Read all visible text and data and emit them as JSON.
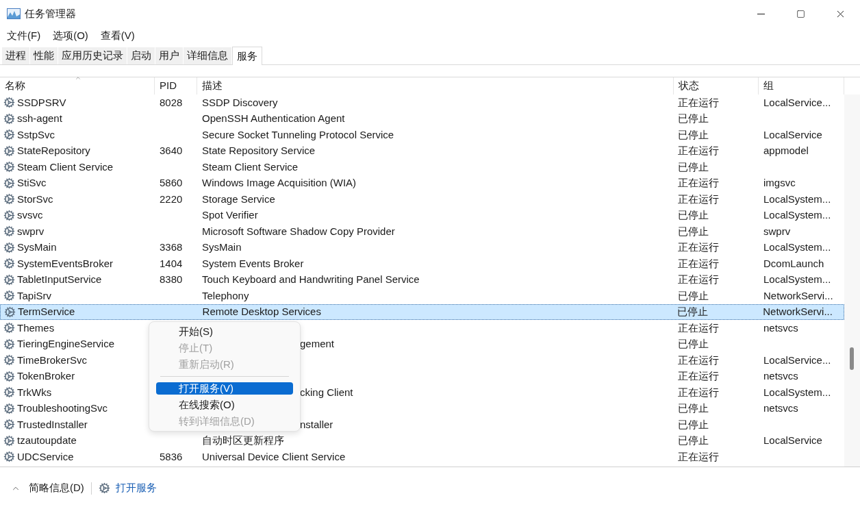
{
  "window": {
    "title": "任务管理器"
  },
  "menu": [
    "文件(F)",
    "选项(O)",
    "查看(V)"
  ],
  "tabs": [
    {
      "label": "进程",
      "selected": false
    },
    {
      "label": "性能",
      "selected": false
    },
    {
      "label": "应用历史记录",
      "selected": false
    },
    {
      "label": "启动",
      "selected": false
    },
    {
      "label": "用户",
      "selected": false
    },
    {
      "label": "详细信息",
      "selected": false
    },
    {
      "label": "服务",
      "selected": true
    }
  ],
  "table": {
    "columns": [
      "名称",
      "PID",
      "描述",
      "状态",
      "组"
    ],
    "rows": [
      {
        "name": "SSDPSRV",
        "pid": "8028",
        "description": "SSDP Discovery",
        "status": "正在运行",
        "group": "LocalService...",
        "selected": false
      },
      {
        "name": "ssh-agent",
        "description": "OpenSSH Authentication Agent",
        "status": "已停止",
        "selected": false
      },
      {
        "name": "SstpSvc",
        "description": "Secure Socket Tunneling Protocol Service",
        "status": "已停止",
        "group": "LocalService",
        "selected": false
      },
      {
        "name": "StateRepository",
        "pid": "3640",
        "description": "State Repository Service",
        "status": "正在运行",
        "group": "appmodel",
        "selected": false
      },
      {
        "name": "Steam Client Service",
        "description": "Steam Client Service",
        "status": "已停止",
        "selected": false
      },
      {
        "name": "StiSvc",
        "pid": "5860",
        "description": "Windows Image Acquisition (WIA)",
        "status": "正在运行",
        "group": "imgsvc",
        "selected": false
      },
      {
        "name": "StorSvc",
        "pid": "2220",
        "description": "Storage Service",
        "status": "正在运行",
        "group": "LocalSystem...",
        "selected": false
      },
      {
        "name": "svsvc",
        "description": "Spot Verifier",
        "status": "已停止",
        "group": "LocalSystem...",
        "selected": false
      },
      {
        "name": "swprv",
        "description": "Microsoft Software Shadow Copy Provider",
        "status": "已停止",
        "group": "swprv",
        "selected": false
      },
      {
        "name": "SysMain",
        "pid": "3368",
        "description": "SysMain",
        "status": "正在运行",
        "group": "LocalSystem...",
        "selected": false
      },
      {
        "name": "SystemEventsBroker",
        "pid": "1404",
        "description": "System Events Broker",
        "status": "正在运行",
        "group": "DcomLaunch",
        "selected": false
      },
      {
        "name": "TabletInputService",
        "pid": "8380",
        "description": "Touch Keyboard and Handwriting Panel Service",
        "status": "正在运行",
        "group": "LocalSystem...",
        "selected": false
      },
      {
        "name": "TapiSrv",
        "description": "Telephony",
        "status": "已停止",
        "group": "NetworkServi...",
        "selected": false
      },
      {
        "name": "TermService",
        "description": "Remote Desktop Services",
        "status": "已停止",
        "group": "NetworkServi...",
        "selected": true
      },
      {
        "name": "Themes",
        "status": "正在运行",
        "group": "netsvcs",
        "selected": false
      },
      {
        "name": "TieringEngineService",
        "description": "gement",
        "status": "已停止",
        "selected": false
      },
      {
        "name": "TimeBrokerSvc",
        "status": "正在运行",
        "group": "LocalService...",
        "selected": false
      },
      {
        "name": "TokenBroker",
        "status": "正在运行",
        "group": "netsvcs",
        "selected": false
      },
      {
        "name": "TrkWks",
        "description": "cking Client",
        "status": "正在运行",
        "group": "LocalSystem...",
        "selected": false
      },
      {
        "name": "TroubleshootingSvc",
        "status": "已停止",
        "group": "netsvcs",
        "selected": false
      },
      {
        "name": "TrustedInstaller",
        "description": "nstaller",
        "status": "已停止",
        "selected": false
      },
      {
        "name": "tzautoupdate",
        "description": "自动时区更新程序",
        "status": "已停止",
        "group": "LocalService",
        "selected": false
      },
      {
        "name": "UDCService",
        "pid": "5836",
        "description": "Universal Device Client Service",
        "status": "正在运行",
        "selected": false
      }
    ]
  },
  "context_menu": [
    {
      "kind": "item",
      "label": "开始(S)",
      "disabled": false,
      "selected": false
    },
    {
      "kind": "item",
      "label": "停止(T)",
      "disabled": true,
      "selected": false
    },
    {
      "kind": "item",
      "label": "重新启动(R)",
      "disabled": true,
      "selected": false
    },
    {
      "kind": "separator"
    },
    {
      "kind": "item",
      "label": "打开服务(V)",
      "disabled": false,
      "selected": true
    },
    {
      "kind": "item",
      "label": "在线搜索(O)",
      "disabled": false,
      "selected": false
    },
    {
      "kind": "item",
      "label": "转到详细信息(D)",
      "disabled": true,
      "selected": false
    }
  ],
  "status_bar": {
    "details_toggle": "简略信息(D)",
    "link": "打开服务"
  }
}
